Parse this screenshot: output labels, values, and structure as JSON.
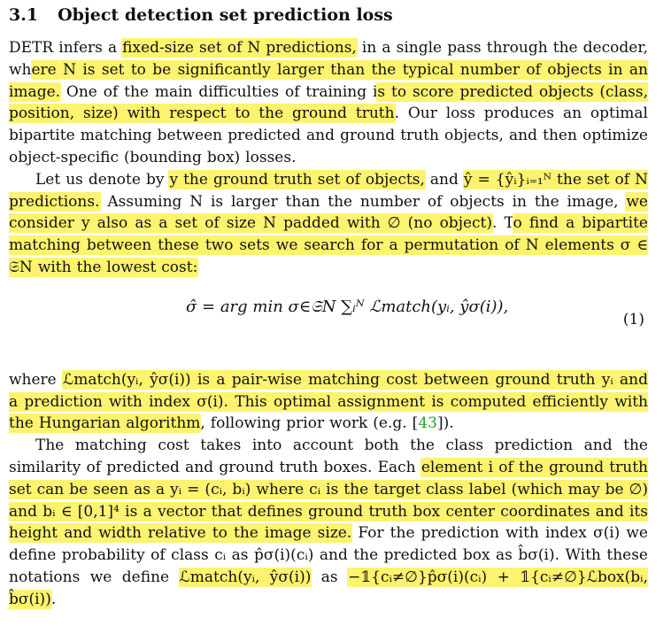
{
  "section": {
    "number": "3.1",
    "title": "Object detection set prediction loss"
  },
  "paragraphs": [
    {
      "indent": false,
      "segments": [
        {
          "text": "DETR infers a ",
          "hl": false
        },
        {
          "text": "fixed-size set of N predictions,",
          "hl": true
        },
        {
          "text": " in a single pass through the decoder, wh",
          "hl": false
        },
        {
          "text": "ere N is set to be significantly larger than the typical number of objects in an image.",
          "hl": true
        },
        {
          "text": " One of the main difficulties of training i",
          "hl": false
        },
        {
          "text": "s to score predicted objects (class, position, size) with respect to the ground truth",
          "hl": true
        },
        {
          "text": ". Our loss produces an optimal bipartite matching between predicted and ground truth objects, and then optimize object-specific (bounding box) losses.",
          "hl": false
        }
      ]
    },
    {
      "indent": true,
      "segments": [
        {
          "text": "Let us denote by ",
          "hl": false
        },
        {
          "text": "y the ground truth set of objects,",
          "hl": true
        },
        {
          "text": " and ",
          "hl": false
        },
        {
          "text": "ŷ = {ŷᵢ}ᵢ₌₁ᴺ the set of N predictions.",
          "hl": true
        },
        {
          "text": " Assuming N is larger than the number of objects in the image, ",
          "hl": false
        },
        {
          "text": "we consider y also as a set of size N padded with ∅ (no object)",
          "hl": true
        },
        {
          "text": ". T",
          "hl": false
        },
        {
          "text": "o find a bipartite matching between these two sets we search for a permutation of N elements σ ∈ 𝔖N with the lowest cost:",
          "hl": true
        }
      ]
    },
    {
      "indent": false,
      "segments": [
        {
          "text": "where ",
          "hl": false
        },
        {
          "text": "ℒmatch(yᵢ, ŷσ(i)) is a pair-wise matching cost between ground truth yᵢ and a prediction with index σ(i). This optimal assignment is computed efficiently with the Hungarian algorithm",
          "hl": true
        },
        {
          "text": ", following prior work (e.g. [",
          "hl": false
        },
        {
          "text": "43",
          "hl": false,
          "ref": true
        },
        {
          "text": "]).",
          "hl": false
        }
      ]
    },
    {
      "indent": true,
      "segments": [
        {
          "text": "The matching cost takes into account both the class prediction and the similarity of predicted and ground truth boxes. Each ",
          "hl": false
        },
        {
          "text": "element i of the ground truth set can be seen as a yᵢ = (cᵢ, bᵢ) where cᵢ is th",
          "hl": true
        },
        {
          "text": "e target class label (which may be ∅) and bᵢ ∈ [0,1]⁴ is a vector that defines ground truth box center coordinates and its height and width relative to the image size.",
          "hl": true
        },
        {
          "text": " For the prediction with index σ(i) we define probability of class cᵢ as p̂σ(i)(cᵢ) and the predicted box as b̂σ(i). With these notations we define ",
          "hl": false
        },
        {
          "text": "ℒmatch(yᵢ, ŷσ(i))",
          "hl": true
        },
        {
          "text": " as ",
          "hl": false
        },
        {
          "text": "−𝟙{cᵢ≠∅}p̂σ(i)(cᵢ) + 𝟙{cᵢ≠∅}ℒbox(bᵢ, b̂σ(i))",
          "hl": true
        },
        {
          "text": ".",
          "hl": false
        }
      ]
    }
  ],
  "equation": {
    "body": "σ̂ = arg min σ∈𝔖N ∑ᵢᴺ ℒmatch(yᵢ, ŷσ(i)),",
    "number": "(1)"
  }
}
